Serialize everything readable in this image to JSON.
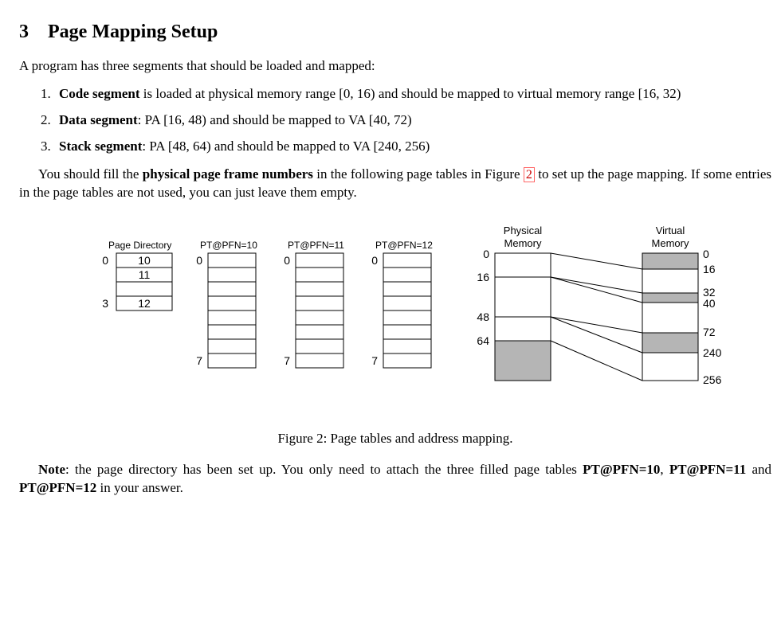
{
  "section": {
    "number": "3",
    "title": "Page Mapping Setup"
  },
  "intro": "A program has three segments that should be loaded and mapped:",
  "segments": [
    {
      "name": "Code segment",
      "desc": " is loaded at physical memory range [0, 16) and should be mapped to virtual memory range [16, 32)"
    },
    {
      "name": "Data segment",
      "desc": ": PA [16, 48) and should be mapped to VA [40, 72)"
    },
    {
      "name": "Stack segment",
      "desc": ": PA [48, 64) and should be mapped to VA [240, 256)"
    }
  ],
  "instr": {
    "pre": "You should fill the ",
    "bold1": "physical page frame numbers",
    "mid": " in the following page tables in Figure ",
    "figref": "2",
    "post": " to set up the page mapping. If some entries in the page tables are not used, you can just leave them empty."
  },
  "figure": {
    "pd_title": "Page Directory",
    "pt_titles": [
      "PT@PFN=10",
      "PT@PFN=11",
      "PT@PFN=12"
    ],
    "pm_title": "Physical",
    "pm_title2": "Memory",
    "vm_title": "Virtual",
    "vm_title2": "Memory",
    "pd_entries": {
      "0": "10",
      "1": "11",
      "3": "12"
    },
    "pd_idx_top": "0",
    "pd_idx_bottom": "3",
    "pt_idx_top": "0",
    "pt_idx_bottom": "7",
    "pm_ticks": [
      "0",
      "16",
      "48",
      "64"
    ],
    "vm_ticks": [
      "0",
      "16",
      "32",
      "40",
      "72",
      "240",
      "256"
    ],
    "caption": "Figure 2: Page tables and address mapping."
  },
  "note": {
    "label": "Note",
    "pre": ": the page directory has been set up. You only need to attach the three filled page tables ",
    "b1": "PT@PFN=10",
    "b2": "PT@PFN=11",
    "b3": "PT@PFN=12",
    "post": " in your answer."
  },
  "chart_data": {
    "type": "table",
    "page_directory": [
      {
        "index": 0,
        "pfn": 10
      },
      {
        "index": 1,
        "pfn": 11
      },
      {
        "index": 3,
        "pfn": 12
      }
    ],
    "page_tables": {
      "PT@PFN=10": [
        null,
        null,
        null,
        null,
        null,
        null,
        null,
        null
      ],
      "PT@PFN=11": [
        null,
        null,
        null,
        null,
        null,
        null,
        null,
        null
      ],
      "PT@PFN=12": [
        null,
        null,
        null,
        null,
        null,
        null,
        null,
        null
      ]
    },
    "physical_memory_boundaries": [
      0,
      16,
      48,
      64
    ],
    "virtual_memory_boundaries": [
      0,
      16,
      32,
      40,
      72,
      240,
      256
    ],
    "mappings": [
      {
        "segment": "code",
        "pa": [
          0,
          16
        ],
        "va": [
          16,
          32
        ]
      },
      {
        "segment": "data",
        "pa": [
          16,
          48
        ],
        "va": [
          40,
          72
        ]
      },
      {
        "segment": "stack",
        "pa": [
          48,
          64
        ],
        "va": [
          240,
          256
        ]
      }
    ]
  }
}
